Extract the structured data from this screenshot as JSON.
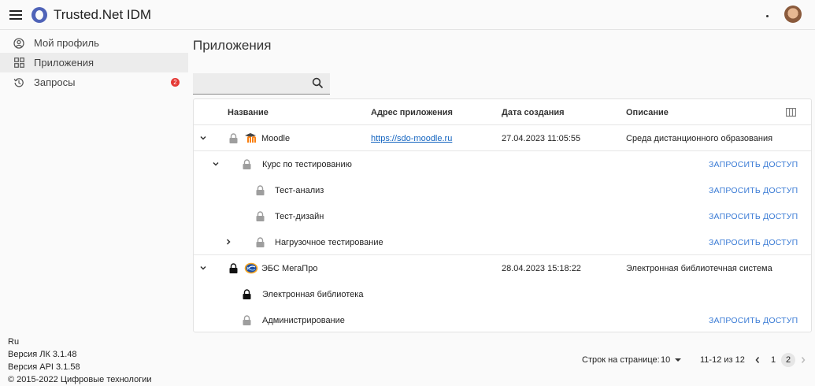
{
  "header": {
    "title": "Trusted.Net IDM"
  },
  "sidebar": {
    "items": [
      {
        "label": "Мой профиль",
        "icon": "account-circle-icon"
      },
      {
        "label": "Приложения",
        "icon": "apps-icon"
      },
      {
        "label": "Запросы",
        "icon": "history-icon",
        "badge": "2"
      }
    ],
    "footer": {
      "lang": "Ru",
      "lk_version": "Версия ЛК 3.1.48",
      "api_version": "Версия API 3.1.58",
      "copyright": "© 2015-2022 Цифровые технологии"
    }
  },
  "main": {
    "title": "Приложения",
    "search": {
      "value": "",
      "placeholder": ""
    },
    "table": {
      "columns": [
        "Название",
        "Адрес приложения",
        "Дата создания",
        "Описание"
      ],
      "request_label": "ЗАПРОСИТЬ ДОСТУП",
      "rows": [
        {
          "name": "Moodle",
          "url": "https://sdo-moodle.ru",
          "created": "27.04.2023 11:05:55",
          "description": "Среда дистанционного образования"
        },
        {
          "name": "Курс по тестированию"
        },
        {
          "name": "Тест-анализ"
        },
        {
          "name": "Тест-дизайн"
        },
        {
          "name": "Нагрузочное тестирование"
        },
        {
          "name": "ЭБС МегаПро",
          "url": "",
          "created": "28.04.2023 15:18:22",
          "description": "Электронная библиотечная система"
        },
        {
          "name": "Электронная библиотека"
        },
        {
          "name": "Администрирование"
        }
      ]
    },
    "pagination": {
      "rows_per_page_label": "Строк на странице:",
      "rows_per_page": "10",
      "range": "11-12 из 12",
      "pages": [
        "1",
        "2"
      ],
      "current_page": "2"
    }
  },
  "colors": {
    "accent": "#3a7bd5",
    "link": "#1565c0",
    "badge": "#e53935",
    "logo": "#4f63b8"
  }
}
